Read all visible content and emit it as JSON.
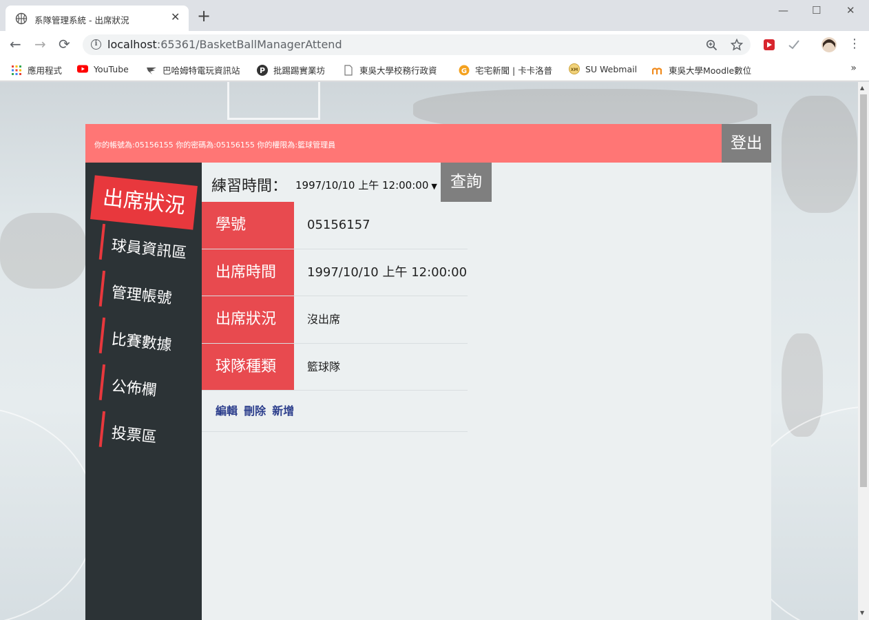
{
  "browser": {
    "tab_title": "系隊管理系統 - 出席狀況",
    "tab_close": "✕",
    "new_tab": "+",
    "url_host": "localhost",
    "url_rest": ":65361/BasketBallManagerAttend",
    "window_controls": {
      "minimize": "—",
      "maximize": "☐",
      "close": "✕"
    },
    "nav": {
      "back": "←",
      "forward": "→",
      "reload": "⟳"
    },
    "bookmarks": [
      {
        "label": "應用程式",
        "color": "#4285f4"
      },
      {
        "label": "YouTube",
        "color": "#ff0000"
      },
      {
        "label": "巴哈姆特電玩資訊站",
        "color": "#2d7bbd"
      },
      {
        "label": "批踢踢實業坊",
        "color": "#333333"
      },
      {
        "label": "東吳大學校務行政資",
        "color": "#9aa0a6"
      },
      {
        "label": "宅宅新聞 | 卡卡洛普",
        "color": "#f4a11e"
      },
      {
        "label": "SU Webmail",
        "color": "#e0b43a"
      },
      {
        "label": "東吳大學Moodle數位",
        "color": "#f08a1c"
      }
    ],
    "bookmarks_more": "»"
  },
  "app": {
    "account_text": "你的帳號為:05156155 你的密碼為:05156155 你的權限為:籃球管理員",
    "logout_label": "登出",
    "sidebar": {
      "active": "出席狀況",
      "items": [
        "球員資訊區",
        "管理帳號",
        "比賽數據",
        "公佈欄",
        "投票區"
      ]
    },
    "query": {
      "label": "練習時間：",
      "selected": "1997/10/10 上午 12:00:00",
      "button": "查詢"
    },
    "detail": [
      {
        "key": "學號",
        "value": "05156157"
      },
      {
        "key": "出席時間",
        "value": "1997/10/10 上午 12:00:00"
      },
      {
        "key": "出席狀況",
        "value": "沒出席"
      },
      {
        "key": "球隊種類",
        "value": "籃球隊"
      }
    ],
    "actions": {
      "edit": "編輯",
      "delete": "刪除",
      "add": "新增"
    }
  },
  "colors": {
    "topbar": "#ff7675",
    "accent_red": "#e8383d",
    "sidebar": "#2c3336",
    "content_bg": "#ecf0f1",
    "gray_button": "#7f7f7f"
  }
}
